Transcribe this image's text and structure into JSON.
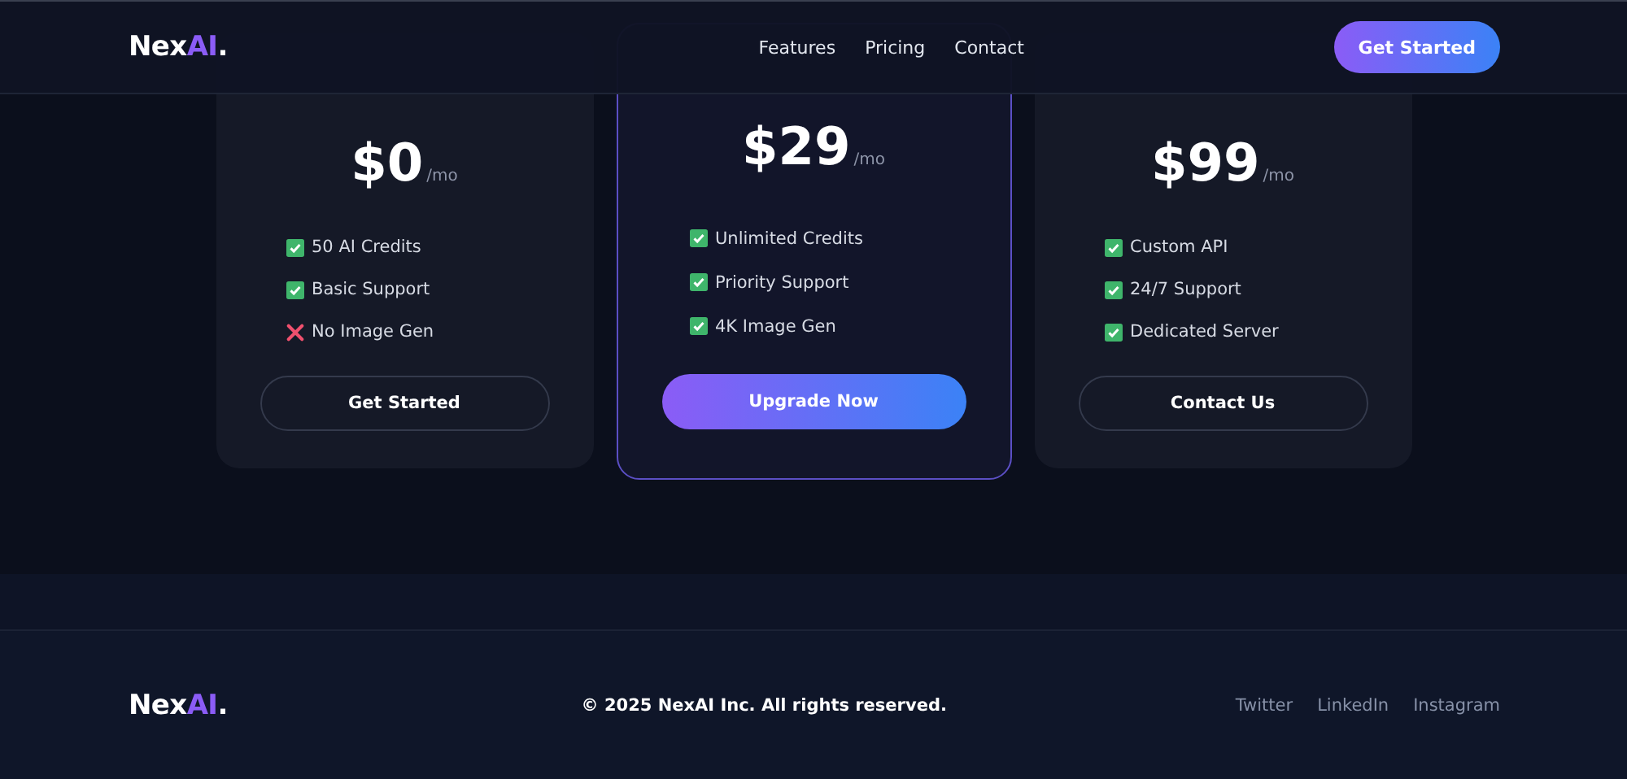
{
  "header": {
    "logo": {
      "text": "Nex",
      "accent": "AI",
      "suffix": "."
    },
    "nav": [
      "Features",
      "Pricing",
      "Contact"
    ],
    "cta": "Get Started"
  },
  "plans": [
    {
      "price": "$0",
      "period": "/mo",
      "featured": false,
      "button": "Get Started",
      "features": [
        {
          "label": "50 AI Credits",
          "included": true
        },
        {
          "label": "Basic Support",
          "included": true
        },
        {
          "label": "No Image Gen",
          "included": false
        }
      ]
    },
    {
      "price": "$29",
      "period": "/mo",
      "featured": true,
      "button": "Upgrade Now",
      "features": [
        {
          "label": "Unlimited Credits",
          "included": true
        },
        {
          "label": "Priority Support",
          "included": true
        },
        {
          "label": "4K Image Gen",
          "included": true
        }
      ]
    },
    {
      "price": "$99",
      "period": "/mo",
      "featured": false,
      "button": "Contact Us",
      "features": [
        {
          "label": "Custom API",
          "included": true
        },
        {
          "label": "24/7 Support",
          "included": true
        },
        {
          "label": "Dedicated Server",
          "included": true
        }
      ]
    }
  ],
  "footer": {
    "logo": {
      "text": "Nex",
      "accent": "AI",
      "suffix": "."
    },
    "copyright": "© 2025 NexAI Inc. All rights reserved.",
    "links": [
      "Twitter",
      "LinkedIn",
      "Instagram"
    ]
  }
}
